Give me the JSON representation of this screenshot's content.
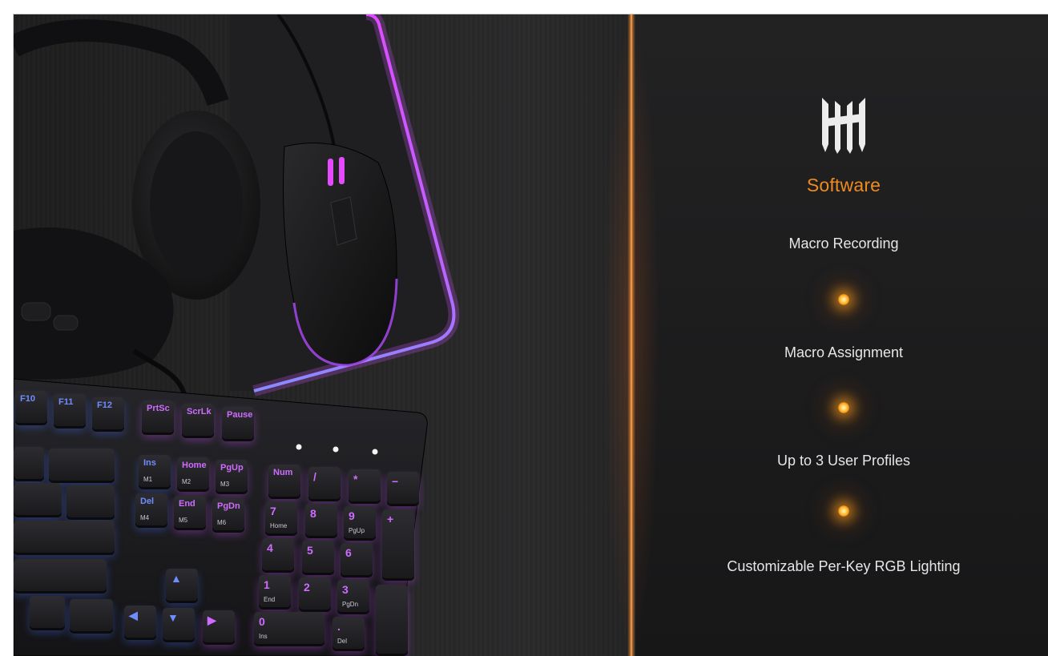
{
  "panel": {
    "heading": "Software",
    "logo": "brand-logo-icon",
    "features": [
      "Macro Recording",
      "Macro Assignment",
      "Up to 3 User Profiles",
      "Customizable Per-Key RGB Lighting"
    ]
  },
  "keyboard": {
    "keys": {
      "f10": "F10",
      "f11": "F11",
      "f12": "F12",
      "prtsc": "PrtSc",
      "scrlk": "ScrLk",
      "pause": "Pause",
      "ins": "Ins",
      "home": "Home",
      "pgup": "PgUp",
      "del": "Del",
      "end": "End",
      "pgdn": "PgDn",
      "num": "Num",
      "slash": "/",
      "star": "*",
      "minus": "−",
      "n7": "7",
      "n8": "8",
      "n9": "9",
      "plus": "+",
      "n4": "4",
      "n5": "5",
      "n6": "6",
      "n1": "1",
      "n2": "2",
      "n3": "3",
      "n0": "0",
      "dot": "."
    },
    "sublabels": {
      "m1": "M1",
      "m2": "M2",
      "m3": "M3",
      "m4": "M4",
      "m5": "M5",
      "m6": "M6",
      "home": "Home",
      "pgup": "PgUp",
      "end": "End",
      "pgdn": "PgDn",
      "ins": "Ins",
      "del": "Del"
    }
  },
  "colors": {
    "accent": "#f08a1e",
    "feature_text": "#e6e6e6",
    "rgb_pink": "#d455ff",
    "rgb_blue": "#4a6dff"
  }
}
